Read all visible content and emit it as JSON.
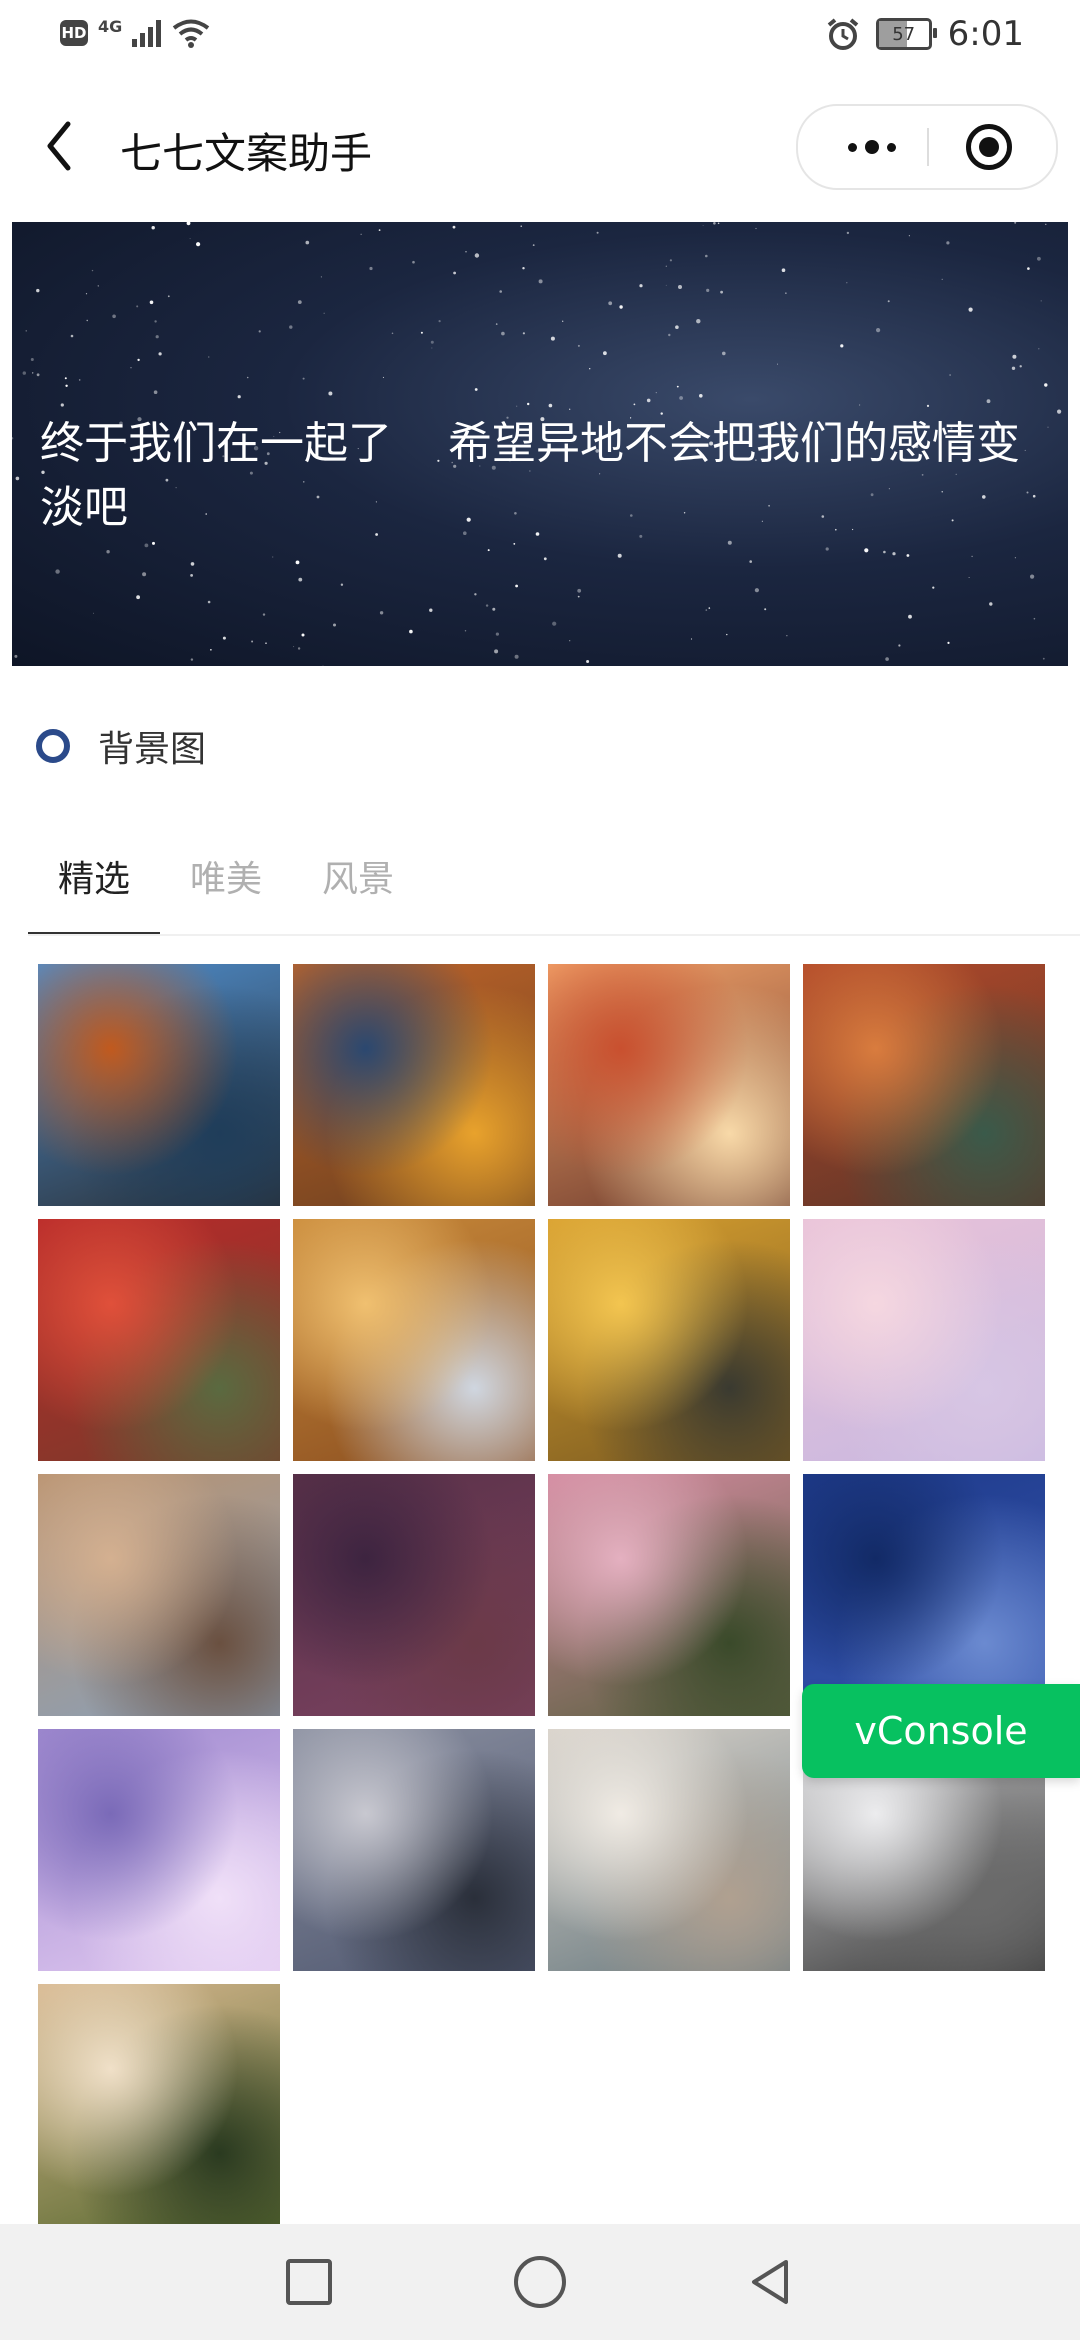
{
  "status_bar": {
    "hd_label": "HD",
    "network_label": "4G",
    "battery_level": 57,
    "battery_text": "57",
    "time": "6:01"
  },
  "nav": {
    "title": "七七文案助手",
    "back_icon": "chevron-left-icon",
    "more_icon": "more-dots-icon",
    "close_icon": "target-close-icon"
  },
  "banner": {
    "text": "终于我们在一起了    希望异地不会把我们的感情变淡吧"
  },
  "background_option": {
    "label": "背景图",
    "selected": false
  },
  "tabs": [
    {
      "label": "精选",
      "active": true
    },
    {
      "label": "唯美",
      "active": false
    },
    {
      "label": "风景",
      "active": false
    }
  ],
  "gallery": {
    "thumbnail_count": 17,
    "thumbs": [
      {
        "colors": [
          "#4f8fcf",
          "#2a2f35",
          "#c15a1e",
          "#1f3d5a"
        ]
      },
      {
        "colors": [
          "#c0652a",
          "#6a3f1f",
          "#2b4870",
          "#e8a22c"
        ]
      },
      {
        "colors": [
          "#f3a36a",
          "#6b3a2c",
          "#c9502f",
          "#f8d9a8"
        ]
      },
      {
        "colors": [
          "#b34a2a",
          "#5b3428",
          "#d97c3e",
          "#3a5a4a"
        ]
      },
      {
        "colors": [
          "#b82a2a",
          "#7a3a2a",
          "#e0503a",
          "#5a6a40"
        ]
      },
      {
        "colors": [
          "#c98a3a",
          "#8a4e20",
          "#f0c070",
          "#cfd6e0"
        ]
      },
      {
        "colors": [
          "#d8a030",
          "#7a5a20",
          "#f3c550",
          "#3a3a30"
        ]
      },
      {
        "colors": [
          "#e9c2d8",
          "#c8b8e0",
          "#f5d7e0",
          "#d7c6e4"
        ]
      },
      {
        "colors": [
          "#b89270",
          "#8aa0b8",
          "#d4b090",
          "#6a5040"
        ]
      },
      {
        "colors": [
          "#5a3148",
          "#7a4260",
          "#3d2440",
          "#6b3a48"
        ]
      },
      {
        "colors": [
          "#d48aa0",
          "#5a6040",
          "#e4b0c0",
          "#3a4a2a"
        ]
      },
      {
        "colors": [
          "#1e3a8a",
          "#3656b0",
          "#122a66",
          "#6b8ad0"
        ]
      },
      {
        "colors": [
          "#a08ad0",
          "#e0c8f0",
          "#7a6ab8",
          "#f0e0f8"
        ]
      },
      {
        "colors": [
          "#8a8fa0",
          "#505870",
          "#c8c8d0",
          "#2a2f3a"
        ]
      },
      {
        "colors": [
          "#d8d2ca",
          "#6a7a80",
          "#f0ebe4",
          "#b0a090"
        ]
      },
      {
        "colors": [
          "#d8d8da",
          "#3a3a3a",
          "#ececee",
          "#6a6a6a"
        ]
      },
      {
        "colors": [
          "#d8b890",
          "#5a6a30",
          "#f0e0c8",
          "#2a3a20"
        ]
      }
    ]
  },
  "vconsole": {
    "label": "vConsole",
    "color": "#07c160"
  },
  "system_nav": {
    "recent_icon": "square-icon",
    "home_icon": "circle-icon",
    "back_icon": "triangle-back-icon"
  }
}
